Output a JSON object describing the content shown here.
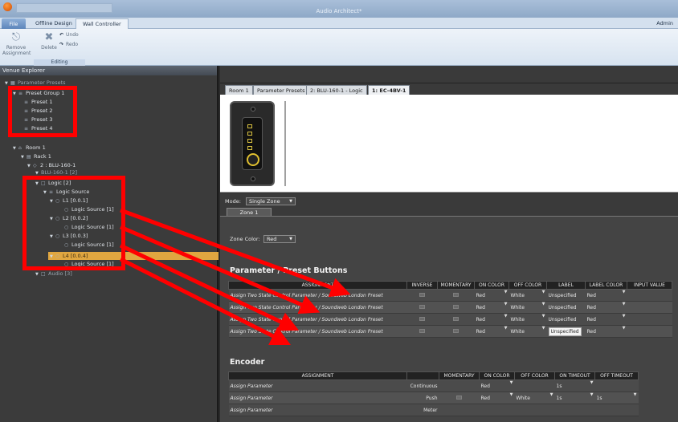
{
  "window": {
    "title": "Audio Architect*",
    "user": "Admin"
  },
  "ribbon": {
    "tabs": [
      "File",
      "Offline Design",
      "Wall Controller"
    ],
    "remove_assignment": "Remove Assignment",
    "delete": "Delete",
    "undo": "Undo",
    "redo": "Redo",
    "group_editing": "Editing"
  },
  "explorer": {
    "title": "Venue Explorer",
    "items": [
      "Parameter Presets",
      "Preset Group 1",
      "Preset 1",
      "Preset 2",
      "Preset 3",
      "Preset 4",
      "Room 1",
      "Rack 1",
      "2 : BLU-160-1",
      "BLU-160-1 [2]",
      "Logic [2]",
      "Logic Source",
      "L1 [0.0.1]",
      "Logic Source [1]",
      "L2 [0.0.2]",
      "Logic Source [1]",
      "L3 [0.0.3]",
      "Logic Source [1]",
      "L4 [0.0.4]",
      "Logic Source [1]",
      "Audio [3]"
    ]
  },
  "doc_tabs": [
    "Room 1",
    "Parameter Presets",
    "2: BLU-160-1 - Logic",
    "1: EC-4BV-1"
  ],
  "mode": {
    "label": "Mode:",
    "value": "Single Zone",
    "zone_tab": "Zone 1"
  },
  "zone_color": {
    "label": "Zone Color:",
    "value": "Red"
  },
  "buttons_section": {
    "title": "Parameter / Preset Buttons",
    "headers": [
      "ASSIGNMENT",
      "INVERSE",
      "MOMENTARY",
      "ON COLOR",
      "OFF COLOR",
      "LABEL",
      "LABEL COLOR",
      "INPUT VALUE"
    ],
    "rows": [
      {
        "assignment": "Assign Two State Control Parameter / Soundweb London Preset",
        "on": "Red",
        "off": "White",
        "label": "Unspecified",
        "label_color": "Red"
      },
      {
        "assignment": "Assign Two State Control Parameter / Soundweb London Preset",
        "on": "Red",
        "off": "White",
        "label": "Unspecified",
        "label_color": "Red"
      },
      {
        "assignment": "Assign Two State Control Parameter / Soundweb London Preset",
        "on": "Red",
        "off": "White",
        "label": "Unspecified",
        "label_color": "Red"
      },
      {
        "assignment": "Assign Two State Control Parameter / Soundweb London Preset",
        "on": "Red",
        "off": "White",
        "label": "Unspecified",
        "label_color": "Red"
      }
    ]
  },
  "encoder_section": {
    "title": "Encoder",
    "headers": [
      "ASSIGNMENT",
      "",
      "MOMENTARY",
      "ON COLOR",
      "OFF COLOR",
      "ON TIMEOUT",
      "OFF TIMEOUT"
    ],
    "rows": [
      {
        "assignment": "Assign Parameter",
        "type": "Continuous",
        "on": "Red",
        "off": "",
        "on_timeout": "1s",
        "off_timeout": ""
      },
      {
        "assignment": "Assign Parameter",
        "type": "Push",
        "on": "Red",
        "off": "White",
        "on_timeout": "1s",
        "off_timeout": "1s"
      },
      {
        "assignment": "Assign Parameter",
        "type": "Meter",
        "on": "",
        "off": "",
        "on_timeout": "",
        "off_timeout": ""
      }
    ]
  },
  "colors": {
    "annotation": "#ff0000",
    "selection": "#e0a640"
  }
}
